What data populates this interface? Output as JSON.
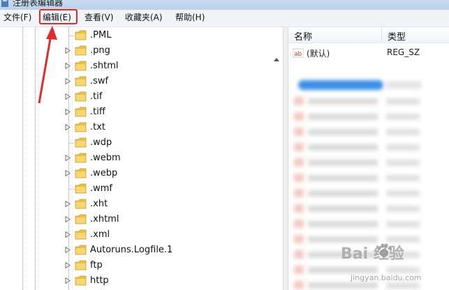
{
  "window": {
    "title": "注册表编辑器"
  },
  "menu": [
    {
      "label": "文件(F)"
    },
    {
      "label": "编辑(E)"
    },
    {
      "label": "查看(V)"
    },
    {
      "label": "收藏夹(A)"
    },
    {
      "label": "帮助(H)"
    }
  ],
  "tree": {
    "items": [
      {
        "label": ".PML",
        "expandable": false
      },
      {
        "label": ".png",
        "expandable": true
      },
      {
        "label": ".shtml",
        "expandable": true
      },
      {
        "label": ".swf",
        "expandable": true
      },
      {
        "label": ".tif",
        "expandable": true
      },
      {
        "label": ".tiff",
        "expandable": true
      },
      {
        "label": ".txt",
        "expandable": true
      },
      {
        "label": ".wdp",
        "expandable": false
      },
      {
        "label": ".webm",
        "expandable": true
      },
      {
        "label": ".webp",
        "expandable": true
      },
      {
        "label": ".wmf",
        "expandable": false
      },
      {
        "label": ".xht",
        "expandable": true
      },
      {
        "label": ".xhtml",
        "expandable": true
      },
      {
        "label": ".xml",
        "expandable": true
      },
      {
        "label": "Autoruns.Logfile.1",
        "expandable": true
      },
      {
        "label": "ftp",
        "expandable": true
      },
      {
        "label": "http",
        "expandable": true
      }
    ]
  },
  "values": {
    "columns": {
      "name": "名称",
      "type": "类型"
    },
    "rows": [
      {
        "name": "(默认)",
        "type": "REG_SZ"
      }
    ]
  },
  "watermark": {
    "logo": "Bai  经验",
    "sub": "jingyan.baidu.com"
  },
  "colors": {
    "highlight": "#e22b2b",
    "folder": "#e8c04a",
    "selection": "#3a8ee6"
  }
}
